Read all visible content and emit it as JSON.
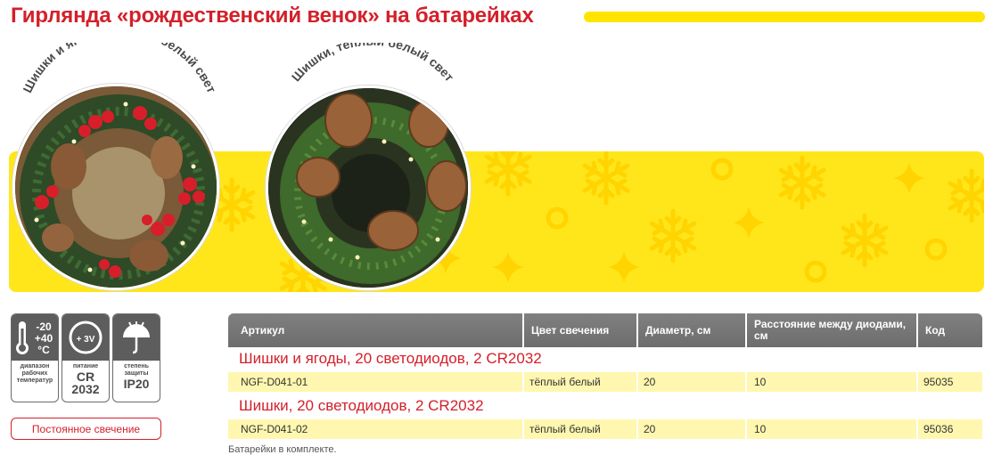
{
  "title": "Гирлянда «рождественский венок» на батарейках",
  "colors": {
    "accent": "#d3202a",
    "yellow": "#ffe61a",
    "gray": "#6d6d6d",
    "row": "#fff7b0"
  },
  "photos": [
    {
      "label": "Шишки и ягоды, тёплый белый свет"
    },
    {
      "label": "Шишки, тёплый белый свет"
    }
  ],
  "specs": {
    "temperature": {
      "top1": "-20",
      "top2": "+40",
      "unit": "°C",
      "caption": "диапазон рабочих температур"
    },
    "power": {
      "voltage": "+ 3V",
      "caption": "питание",
      "value": "CR 2032"
    },
    "ip": {
      "caption": "степень защиты",
      "value": "IP20"
    }
  },
  "badge": "Постоянное свечение",
  "table": {
    "headers": [
      "Артикул",
      "Цвет свечения",
      "Диаметр, см",
      "Расстояние между диодами, см",
      "Код"
    ],
    "groups": [
      {
        "title": "Шишки и ягоды, 20 светодиодов, 2 CR2032",
        "row": {
          "article": "NGF-D041-01",
          "color": "тёплый белый",
          "diameter": "20",
          "distance": "10",
          "code": "95035"
        }
      },
      {
        "title": "Шишки, 20 светодиодов, 2 CR2032",
        "row": {
          "article": "NGF-D041-02",
          "color": "тёплый белый",
          "diameter": "20",
          "distance": "10",
          "code": "95036"
        }
      }
    ]
  },
  "footnote": "Батарейки в комплекте."
}
